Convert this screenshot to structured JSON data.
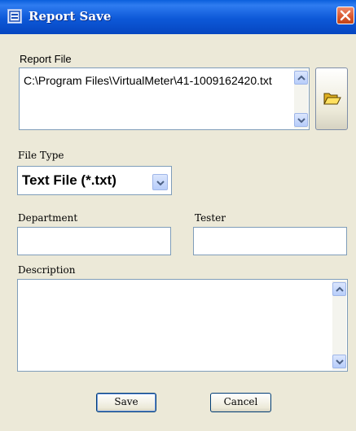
{
  "window": {
    "title": "Report Save",
    "icon": "report-window-icon",
    "close_icon": "close-icon"
  },
  "report_file": {
    "label": "Report File",
    "value": "C:\\Program Files\\VirtualMeter\\41-1009162420.txt",
    "browse_icon": "open-folder-icon"
  },
  "file_type": {
    "label": "File Type",
    "selected": "Text File (*.txt)"
  },
  "department": {
    "label": "Department",
    "value": ""
  },
  "tester": {
    "label": "Tester",
    "value": ""
  },
  "description": {
    "label": "Description",
    "value": ""
  },
  "buttons": {
    "save": "Save",
    "cancel": "Cancel"
  },
  "colors": {
    "titlebar": "#0a5fdc",
    "dialog_bg": "#ece9d8",
    "field_border": "#7f9db9",
    "close_button": "#d8552c"
  }
}
